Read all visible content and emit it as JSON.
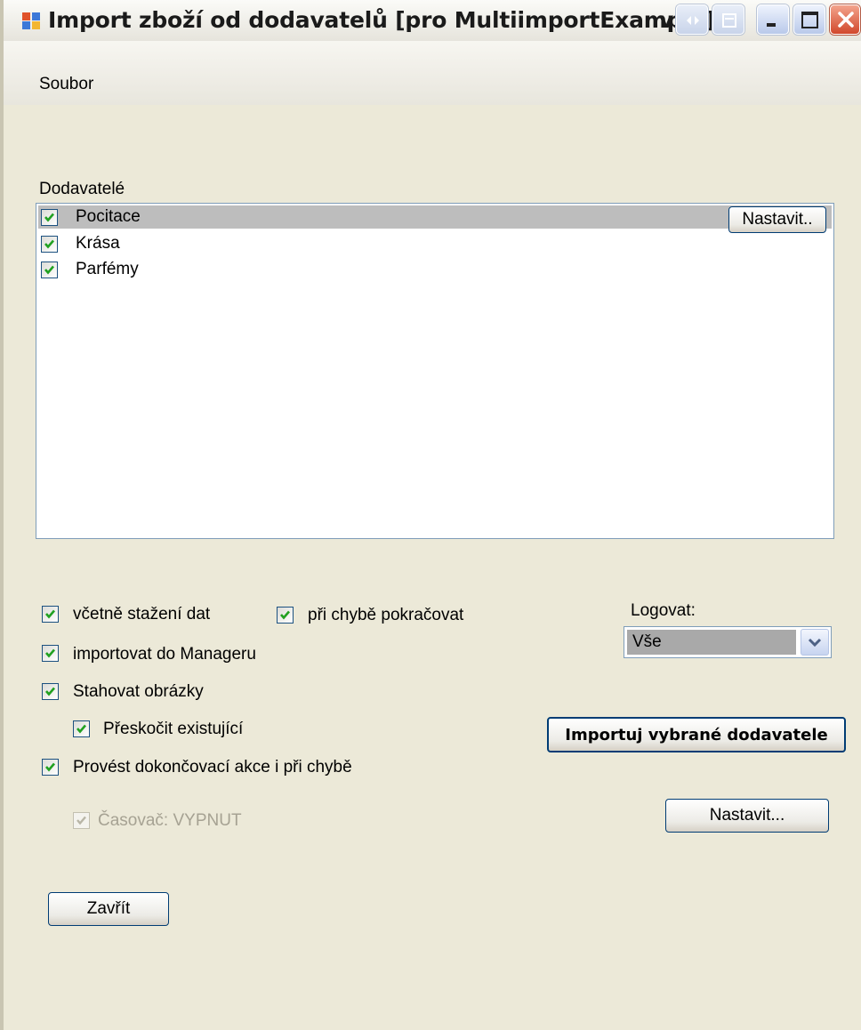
{
  "window": {
    "title": "Import zboží od dodavatelů [pro MultiimportExample]",
    "title_fragment": "v"
  },
  "menu": {
    "items": [
      "Soubor"
    ]
  },
  "suppliers": {
    "label": "Dodavatelé",
    "items": [
      {
        "name": "Pocitace",
        "checked": true,
        "selected": true
      },
      {
        "name": "Krása",
        "checked": true,
        "selected": false
      },
      {
        "name": "Parfémy",
        "checked": true,
        "selected": false
      }
    ],
    "settings_button": "Nastavit.."
  },
  "options": {
    "download_data": {
      "label": "včetně stažení dat",
      "checked": true
    },
    "continue_on_error": {
      "label": "při chybě pokračovat",
      "checked": true
    },
    "import_to_manager": {
      "label": "importovat do Manageru",
      "checked": true
    },
    "download_images": {
      "label": "Stahovat obrázky",
      "checked": true
    },
    "skip_existing": {
      "label": "Přeskočit existující",
      "checked": true
    },
    "finalize_on_error": {
      "label": "Provést dokončovací akce i při chybě",
      "checked": true
    },
    "timer": {
      "label": "Časovač: VYPNUT",
      "checked": true,
      "disabled": true
    }
  },
  "logging": {
    "label": "Logovat:",
    "value": "Vše"
  },
  "buttons": {
    "timer_settings": "Nastavit...",
    "import": "Importuj vybrané dodavatele",
    "close": "Zavřít"
  },
  "colors": {
    "selection": "#bdbdbd",
    "window_bg": "#ece9d8",
    "checkmark": "#21a121"
  }
}
